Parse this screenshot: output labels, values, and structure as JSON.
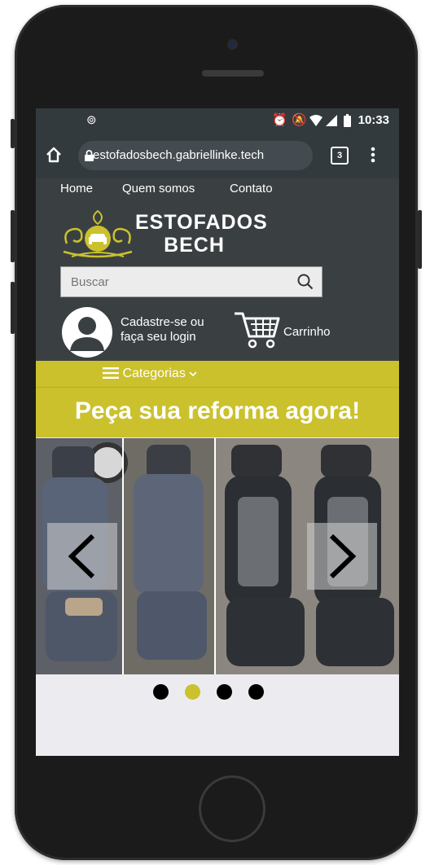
{
  "status_bar": {
    "time": "10:33",
    "icons": [
      "notification-icon",
      "alarm-icon",
      "mute-icon",
      "wifi-icon",
      "signal-icon",
      "battery-icon"
    ]
  },
  "browser": {
    "url": "estofadosbech.gabriellinke.tech",
    "tab_count": "3",
    "icons": [
      "home-icon",
      "lock-icon",
      "menu-dots-icon"
    ]
  },
  "site": {
    "nav": [
      "Home",
      "Quem somos",
      "Contato"
    ],
    "brand_line1": "ESTOFADOS",
    "brand_line2": "BECH",
    "search_placeholder": "Buscar",
    "login_line1": "Cadastre-se ou",
    "login_line2": "faça seu login",
    "cart_label": "Carrinho",
    "categories_label": "Categorias"
  },
  "banner": {
    "text": "Peça sua reforma agora!"
  },
  "carousel": {
    "slide_count": 4,
    "active_index": 1
  },
  "colors": {
    "accent": "#cbc12d",
    "header_bg": "#3a4042",
    "chrome_bg": "#333a3e"
  }
}
